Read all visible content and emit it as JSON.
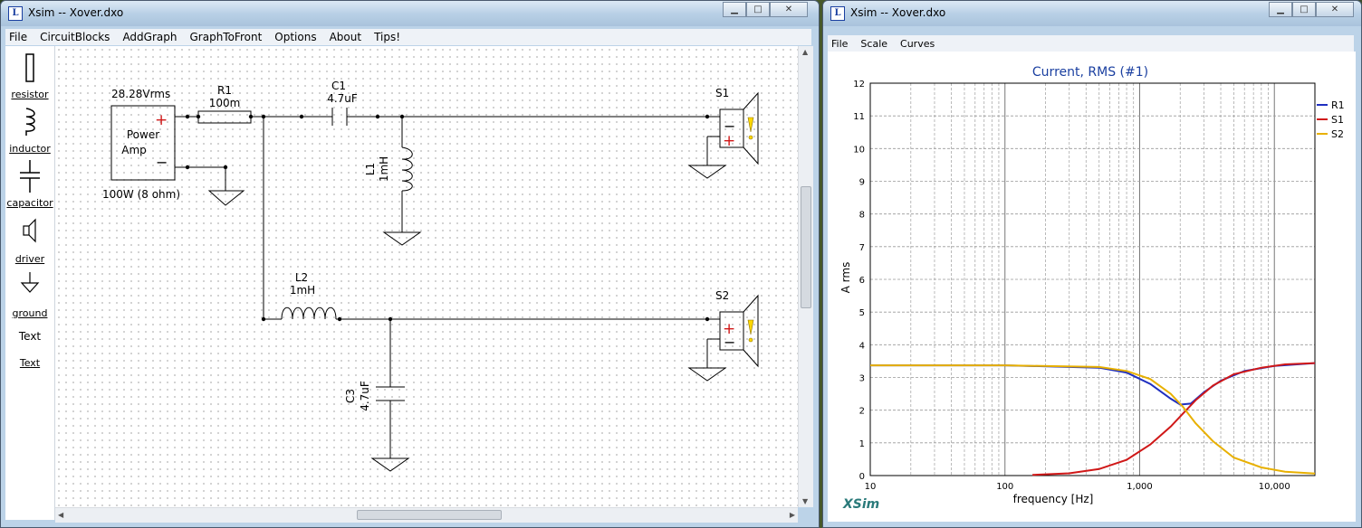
{
  "left_window": {
    "title": "Xsim -- Xover.dxo",
    "menu": [
      "File",
      "CircuitBlocks",
      "AddGraph",
      "GraphToFront",
      "Options",
      "About",
      "Tips!"
    ],
    "palette": [
      {
        "label": "resistor",
        "icon": "resistor-icon"
      },
      {
        "label": "inductor",
        "icon": "inductor-icon"
      },
      {
        "label": "capacitor",
        "icon": "capacitor-icon"
      },
      {
        "label": "driver",
        "icon": "driver-icon"
      },
      {
        "label": "ground",
        "icon": "ground-icon"
      },
      {
        "label": "Text",
        "icon_text": "Text"
      }
    ],
    "circuit": {
      "amp_voltage": "28.28Vrms",
      "amp_name_1": "Power",
      "amp_name_2": "Amp",
      "amp_plus": "+",
      "amp_minus": "−",
      "amp_rating": "100W (8 ohm)",
      "r1_name": "R1",
      "r1_value": "100m",
      "c1_name": "C1",
      "c1_value": "4.7uF",
      "l1_name": "L1",
      "l1_value": "1mH",
      "l2_name": "L2",
      "l2_value": "1mH",
      "c3_name": "C3",
      "c3_value": "4.7uF",
      "s1_name": "S1",
      "s2_name": "S2"
    }
  },
  "right_window": {
    "title": "Xsim -- Xover.dxo",
    "menu": [
      "File",
      "Scale",
      "Curves"
    ],
    "watermark": "XSim"
  },
  "colors": {
    "r1": "#1f2fc0",
    "s1": "#d01818",
    "s2": "#e8b000",
    "title_blue": "#1a3fa0",
    "watermark": "#2a7a7a"
  },
  "chart_data": {
    "type": "line",
    "title": "Current, RMS (#1)",
    "xlabel": "frequency [Hz]",
    "ylabel": "A rms",
    "xscale": "log",
    "xlim": [
      10,
      20000
    ],
    "ylim": [
      0,
      12
    ],
    "yticks": [
      0,
      1,
      2,
      3,
      4,
      5,
      6,
      7,
      8,
      9,
      10,
      11,
      12
    ],
    "xtick_labels": [
      {
        "v": 10,
        "t": "10"
      },
      {
        "v": 100,
        "t": "100"
      },
      {
        "v": 1000,
        "t": "1,000"
      },
      {
        "v": 10000,
        "t": "10,000"
      }
    ],
    "grid": true,
    "legend": "top-right",
    "series": [
      {
        "name": "R1",
        "color": "#1f2fc0",
        "points": [
          [
            10,
            3.37
          ],
          [
            100,
            3.37
          ],
          [
            500,
            3.3
          ],
          [
            800,
            3.15
          ],
          [
            1200,
            2.8
          ],
          [
            1700,
            2.35
          ],
          [
            2000,
            2.17
          ],
          [
            2400,
            2.2
          ],
          [
            3000,
            2.55
          ],
          [
            4000,
            2.9
          ],
          [
            6000,
            3.2
          ],
          [
            10000,
            3.35
          ],
          [
            20000,
            3.44
          ]
        ]
      },
      {
        "name": "S1",
        "color": "#d01818",
        "points": [
          [
            160,
            0.02
          ],
          [
            300,
            0.07
          ],
          [
            500,
            0.2
          ],
          [
            800,
            0.48
          ],
          [
            1200,
            0.95
          ],
          [
            1700,
            1.5
          ],
          [
            2100,
            1.9
          ],
          [
            2600,
            2.3
          ],
          [
            3500,
            2.75
          ],
          [
            5000,
            3.1
          ],
          [
            8000,
            3.3
          ],
          [
            12000,
            3.4
          ],
          [
            20000,
            3.44
          ]
        ]
      },
      {
        "name": "S2",
        "color": "#e8b000",
        "points": [
          [
            10,
            3.37
          ],
          [
            100,
            3.37
          ],
          [
            500,
            3.32
          ],
          [
            800,
            3.2
          ],
          [
            1200,
            2.95
          ],
          [
            1700,
            2.5
          ],
          [
            2100,
            2.1
          ],
          [
            2600,
            1.6
          ],
          [
            3500,
            1.05
          ],
          [
            5000,
            0.55
          ],
          [
            8000,
            0.25
          ],
          [
            12000,
            0.12
          ],
          [
            20000,
            0.06
          ]
        ]
      }
    ]
  }
}
